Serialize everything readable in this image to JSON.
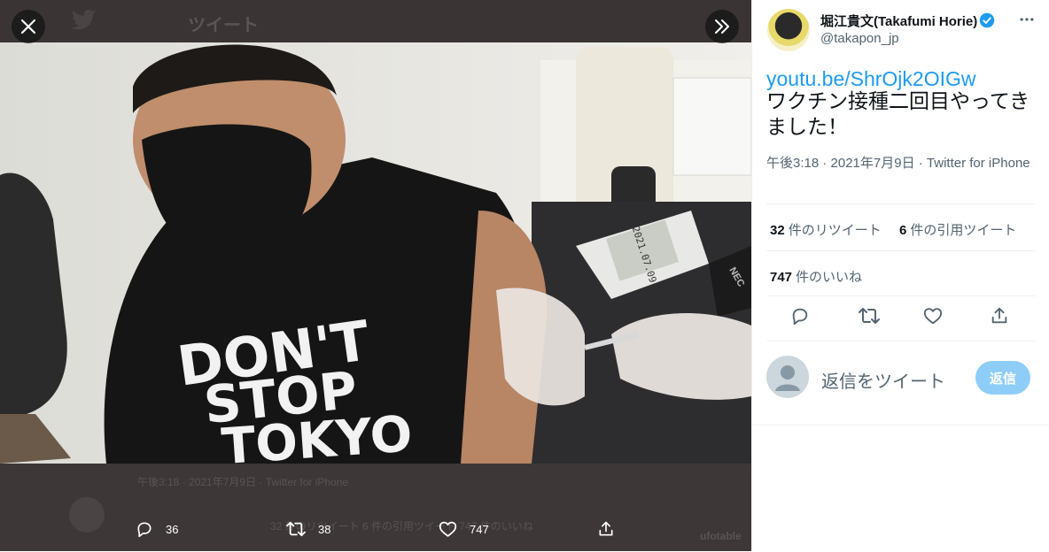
{
  "viewer": {
    "bg_title": "ツイート",
    "bg_meta": "午後3:18 · 2021年7月9日 · Twitter for iPhone",
    "bg_stats": "32 件のリツイート   6 件の引用ツイート   747 件のいいね",
    "bg_side": "ufotable",
    "shirt_lines": [
      "DON'T",
      "STOP",
      "TOKYO"
    ],
    "device_label": "NEC",
    "screen_digits": "2021.07.09",
    "actions": {
      "reply_count": "36",
      "retweet_count": "38",
      "like_count": "747"
    }
  },
  "tweet": {
    "author_name": "堀江貴文(Takafumi Horie)",
    "author_handle": "@takapon_jp",
    "link": "youtu.be/ShrOjk2OIGw",
    "text": "ワクチン接種二回目やってきました！",
    "meta": "午後3:18 · 2021年7月9日 · Twitter for iPhone",
    "retweets_count": "32",
    "retweets_label": "件のリツイート",
    "quotes_count": "6",
    "quotes_label": "件の引用ツイート",
    "likes_count": "747",
    "likes_label": "件のいいね"
  },
  "reply": {
    "placeholder": "返信をツイート",
    "button": "返信"
  },
  "colors": {
    "accent": "#1d9bf0",
    "reply_button": "#8ecdf8",
    "viewer_bg": "#3b3535"
  }
}
